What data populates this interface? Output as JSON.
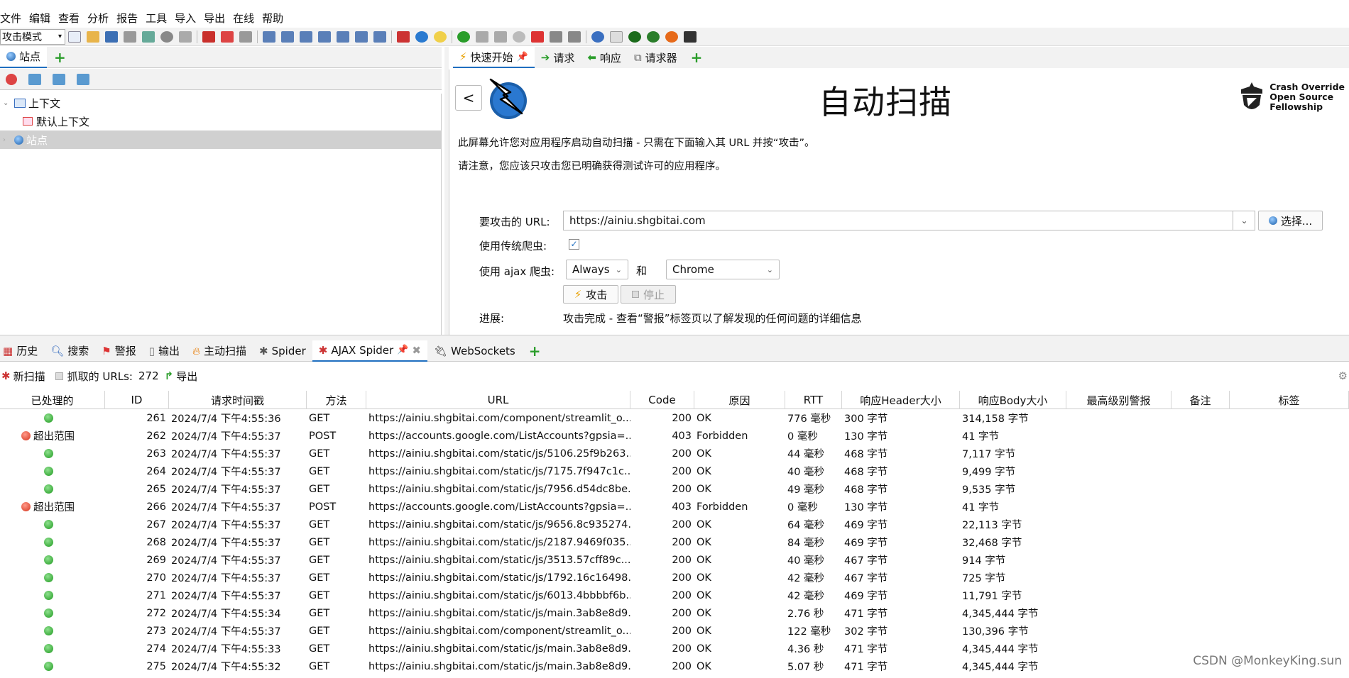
{
  "menu": [
    "文件",
    "编辑",
    "查看",
    "分析",
    "报告",
    "工具",
    "导入",
    "导出",
    "在线",
    "帮助"
  ],
  "toolbar": {
    "mode": "攻击模式"
  },
  "sites_panel": {
    "tab_label": "站点",
    "tree": [
      {
        "label": "上下文"
      },
      {
        "label": "默认上下文"
      },
      {
        "label": "站点"
      }
    ]
  },
  "workspace_tabs": [
    {
      "label": "快速开始"
    },
    {
      "label": "请求"
    },
    {
      "label": "响应"
    },
    {
      "label": "请求器"
    }
  ],
  "quick_start": {
    "back_label": "<",
    "title": "自动扫描",
    "brand": [
      "Crash Override",
      "Open Source",
      "Fellowship"
    ],
    "desc1": "此屏幕允许您对应用程序启动自动扫描 - 只需在下面输入其 URL 并按“攻击”。",
    "desc2": "请注意，您应该只攻击您已明确获得测试许可的应用程序。",
    "url_label": "要攻击的 URL:",
    "url_value": "https://ainiu.shgbitai.com",
    "choose_label": "选择...",
    "traditional_label": "使用传统爬虫:",
    "ajax_label": "使用 ajax 爬虫:",
    "ajax_mode": "Always",
    "and_label": "和",
    "browser": "Chrome",
    "attack_label": "攻击",
    "stop_label": "停止",
    "progress_label": "进展:",
    "progress_value": "攻击完成 - 查看“警报”标签页以了解发现的任何问题的详细信息"
  },
  "bottom_tabs": [
    {
      "label": "历史"
    },
    {
      "label": "搜索"
    },
    {
      "label": "警报"
    },
    {
      "label": "输出"
    },
    {
      "label": "主动扫描"
    },
    {
      "label": "Spider"
    },
    {
      "label": "AJAX Spider"
    },
    {
      "label": "WebSockets"
    }
  ],
  "ajax_tools": {
    "new_scan": "新扫描",
    "urls_label": "抓取的 URLs:",
    "urls_count": "272",
    "export": "导出"
  },
  "table": {
    "columns": [
      "已处理的",
      "ID",
      "请求时间戳",
      "方法",
      "URL",
      "Code",
      "原因",
      "RTT",
      "响应Header大小",
      "响应Body大小",
      "最高级别警报",
      "备注",
      "标签"
    ],
    "rows": [
      {
        "status": "green",
        "processed": "",
        "id": "261",
        "time": "2024/7/4 下午4:55:36",
        "method": "GET",
        "url": "https://ainiu.shgbitai.com/component/streamlit_o...",
        "code": "200",
        "reason": "OK",
        "rtt": "776 毫秒",
        "hsize": "300 字节",
        "bsize": "314,158 字节"
      },
      {
        "status": "red",
        "processed": "超出范围",
        "id": "262",
        "time": "2024/7/4 下午4:55:37",
        "method": "POST",
        "url": "https://accounts.google.com/ListAccounts?gpsia=...",
        "code": "403",
        "reason": "Forbidden",
        "rtt": "0 毫秒",
        "hsize": "130 字节",
        "bsize": "41 字节"
      },
      {
        "status": "green",
        "processed": "",
        "id": "263",
        "time": "2024/7/4 下午4:55:37",
        "method": "GET",
        "url": "https://ainiu.shgbitai.com/static/js/5106.25f9b263....",
        "code": "200",
        "reason": "OK",
        "rtt": "44 毫秒",
        "hsize": "468 字节",
        "bsize": "7,117 字节"
      },
      {
        "status": "green",
        "processed": "",
        "id": "264",
        "time": "2024/7/4 下午4:55:37",
        "method": "GET",
        "url": "https://ainiu.shgbitai.com/static/js/7175.7f947c1c....",
        "code": "200",
        "reason": "OK",
        "rtt": "40 毫秒",
        "hsize": "468 字节",
        "bsize": "9,499 字节"
      },
      {
        "status": "green",
        "processed": "",
        "id": "265",
        "time": "2024/7/4 下午4:55:37",
        "method": "GET",
        "url": "https://ainiu.shgbitai.com/static/js/7956.d54dc8be...",
        "code": "200",
        "reason": "OK",
        "rtt": "49 毫秒",
        "hsize": "468 字节",
        "bsize": "9,535 字节"
      },
      {
        "status": "red",
        "processed": "超出范围",
        "id": "266",
        "time": "2024/7/4 下午4:55:37",
        "method": "POST",
        "url": "https://accounts.google.com/ListAccounts?gpsia=...",
        "code": "403",
        "reason": "Forbidden",
        "rtt": "0 毫秒",
        "hsize": "130 字节",
        "bsize": "41 字节"
      },
      {
        "status": "green",
        "processed": "",
        "id": "267",
        "time": "2024/7/4 下午4:55:37",
        "method": "GET",
        "url": "https://ainiu.shgbitai.com/static/js/9656.8c935274....",
        "code": "200",
        "reason": "OK",
        "rtt": "64 毫秒",
        "hsize": "469 字节",
        "bsize": "22,113 字节"
      },
      {
        "status": "green",
        "processed": "",
        "id": "268",
        "time": "2024/7/4 下午4:55:37",
        "method": "GET",
        "url": "https://ainiu.shgbitai.com/static/js/2187.9469f035....",
        "code": "200",
        "reason": "OK",
        "rtt": "84 毫秒",
        "hsize": "469 字节",
        "bsize": "32,468 字节"
      },
      {
        "status": "green",
        "processed": "",
        "id": "269",
        "time": "2024/7/4 下午4:55:37",
        "method": "GET",
        "url": "https://ainiu.shgbitai.com/static/js/3513.57cff89c....",
        "code": "200",
        "reason": "OK",
        "rtt": "40 毫秒",
        "hsize": "467 字节",
        "bsize": "914 字节"
      },
      {
        "status": "green",
        "processed": "",
        "id": "270",
        "time": "2024/7/4 下午4:55:37",
        "method": "GET",
        "url": "https://ainiu.shgbitai.com/static/js/1792.16c16498....",
        "code": "200",
        "reason": "OK",
        "rtt": "42 毫秒",
        "hsize": "467 字节",
        "bsize": "725 字节"
      },
      {
        "status": "green",
        "processed": "",
        "id": "271",
        "time": "2024/7/4 下午4:55:37",
        "method": "GET",
        "url": "https://ainiu.shgbitai.com/static/js/6013.4bbbbf6b...",
        "code": "200",
        "reason": "OK",
        "rtt": "42 毫秒",
        "hsize": "469 字节",
        "bsize": "11,791 字节"
      },
      {
        "status": "green",
        "processed": "",
        "id": "272",
        "time": "2024/7/4 下午4:55:34",
        "method": "GET",
        "url": "https://ainiu.shgbitai.com/static/js/main.3ab8e8d9...",
        "code": "200",
        "reason": "OK",
        "rtt": "2.76 秒",
        "hsize": "471 字节",
        "bsize": "4,345,444 字节"
      },
      {
        "status": "green",
        "processed": "",
        "id": "273",
        "time": "2024/7/4 下午4:55:37",
        "method": "GET",
        "url": "https://ainiu.shgbitai.com/component/streamlit_o...",
        "code": "200",
        "reason": "OK",
        "rtt": "122 毫秒",
        "hsize": "302 字节",
        "bsize": "130,396 字节"
      },
      {
        "status": "green",
        "processed": "",
        "id": "274",
        "time": "2024/7/4 下午4:55:33",
        "method": "GET",
        "url": "https://ainiu.shgbitai.com/static/js/main.3ab8e8d9...",
        "code": "200",
        "reason": "OK",
        "rtt": "4.36 秒",
        "hsize": "471 字节",
        "bsize": "4,345,444 字节"
      },
      {
        "status": "green",
        "processed": "",
        "id": "275",
        "time": "2024/7/4 下午4:55:32",
        "method": "GET",
        "url": "https://ainiu.shgbitai.com/static/js/main.3ab8e8d9...",
        "code": "200",
        "reason": "OK",
        "rtt": "5.07 秒",
        "hsize": "471 字节",
        "bsize": "4,345,444 字节"
      }
    ]
  },
  "watermark": "CSDN @MonkeyKing.sun"
}
